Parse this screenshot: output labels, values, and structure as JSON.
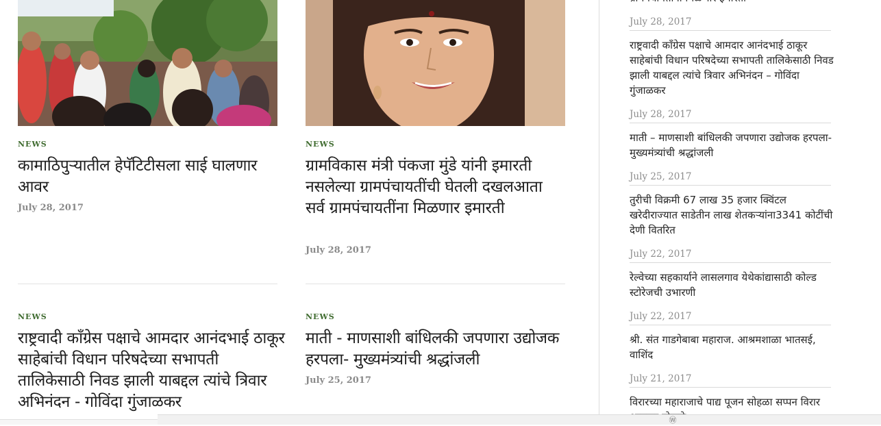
{
  "posts": [
    {
      "category": "NEWS",
      "title": "कामाठिपुऱ्यातील हेपॅटिटीसला साई घालणार आवर",
      "date": "July 28, 2017"
    },
    {
      "category": "NEWS",
      "title": "ग्रामविकास मंत्री पंकजा मुंडे यांनी इमारती नसलेल्या ग्रामपंचायतींची घेतली दखलआता सर्व ग्रामपंचायतींना मिळणार इमारती",
      "date": "July 28, 2017"
    },
    {
      "category": "NEWS",
      "title": "राष्ट्रवादी काँग्रेस पक्षाचे आमदार आनंदभाई ठाकूर साहेबांची विधान परिषदेच्या सभापती तालिकेसाठी निवड झाली याबद्दल त्यांचे त्रिवार अभिनंदन - गोविंदा गुंजाळकर",
      "date": ""
    },
    {
      "category": "NEWS",
      "title": "माती - माणसाशी बांधिलकी जपणारा उद्योजक हरपला- मुख्यमंत्र्यांची श्रद्धांजली",
      "date": "July 25, 2017"
    }
  ],
  "sidebar": {
    "top_cut_link": "ग्रामपंचायतींना मिळणार इमारती",
    "items": [
      {
        "date": "July 28, 2017",
        "title": "राष्ट्रवादी काँग्रेस पक्षाचे आमदार आनंदभाई ठाकूर साहेबांची विधान परिषदेच्या सभापती तालिकेसाठी निवड झाली याबद्दल त्यांचे त्रिवार अभिनंदन – गोविंदा गुंजाळकर"
      },
      {
        "date": "July 28, 2017",
        "title": "माती – माणसाशी बांधिलकी जपणारा उद्योजक हरपला- मुख्यमंत्र्यांची श्रद्धांजली"
      },
      {
        "date": "July 25, 2017",
        "title": "तुरीची विक्रमी 67 लाख 35 हजार क्विंटल खरेदीराज्यात साडेतीन लाख शेतकऱ्यांना3341 कोटींची देणी वितरित"
      },
      {
        "date": "July 22, 2017",
        "title": "रेल्वेच्या सहकार्याने लासलगाव येथेकांद्यासाठी कोल्ड स्टोरेजची उभारणी"
      },
      {
        "date": "July 22, 2017",
        "title": "श्री. संत गाडगेबाबा महाराज. आश्रमशाळा भातसई, वाशिंद"
      },
      {
        "date": "July 21, 2017",
        "title": "विरारच्या महाराजाचे पाद्य पूजन सोहळा सप्पन विरार आमदार पोकळे"
      }
    ]
  },
  "colors": {
    "category_green": "#3f6b2f",
    "date_gray": "#8a8a8a"
  }
}
